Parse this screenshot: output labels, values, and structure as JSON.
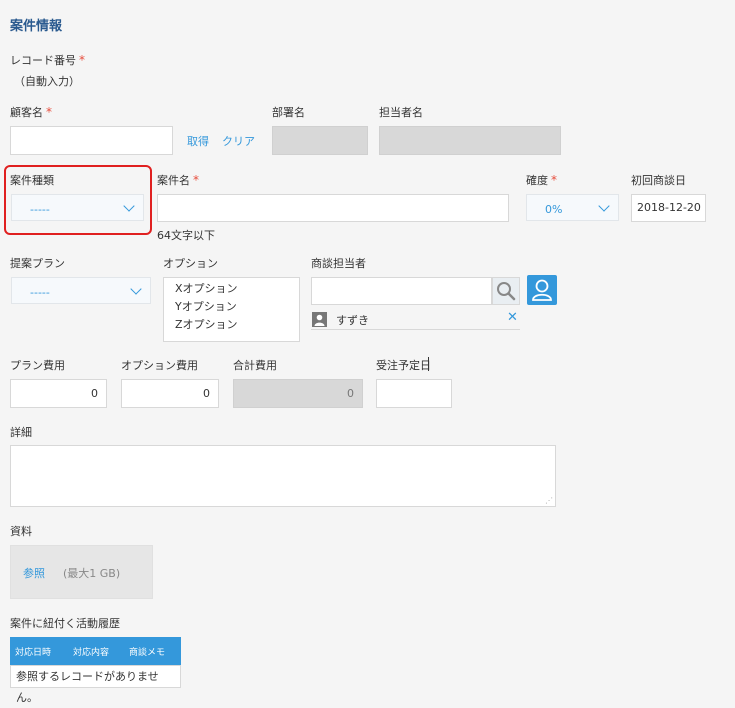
{
  "section_title": "案件情報",
  "record_number": {
    "label": "レコード番号",
    "value": "（自動入力）"
  },
  "customer": {
    "label": "顧客名",
    "fetch_label": "取得",
    "clear_label": "クリア"
  },
  "department": {
    "label": "部署名"
  },
  "person_in_charge": {
    "label": "担当者名"
  },
  "case_type": {
    "label": "案件種類",
    "value": "-----"
  },
  "case_name": {
    "label": "案件名",
    "hint": "64文字以下"
  },
  "certainty": {
    "label": "確度",
    "value": "0%"
  },
  "first_meeting": {
    "label": "初回商談日",
    "value": "2018-12-20"
  },
  "proposal_plan": {
    "label": "提案プラン",
    "value": "-----"
  },
  "options": {
    "label": "オプション",
    "items": [
      "Xオプション",
      "Yオプション",
      "Zオプション"
    ]
  },
  "sales_rep": {
    "label": "商談担当者",
    "selected": "すずき"
  },
  "plan_cost": {
    "label": "プラン費用",
    "value": "0"
  },
  "option_cost": {
    "label": "オプション費用",
    "value": "0"
  },
  "total_cost": {
    "label": "合計費用",
    "value": "0"
  },
  "order_date": {
    "label": "受注予定日"
  },
  "details": {
    "label": "詳細"
  },
  "materials": {
    "label": "資料",
    "browse_label": "参照",
    "limit": "(最大1 GB)"
  },
  "activity": {
    "label": "案件に紐付く活動履歴",
    "columns": [
      "対応日時",
      "対応内容",
      "商談メモ"
    ],
    "empty": "参照するレコードがありません。"
  },
  "colors": {
    "accent": "#3498db",
    "required": "#e74c3c",
    "highlight": "#e02020",
    "title": "#2a5a8f"
  }
}
